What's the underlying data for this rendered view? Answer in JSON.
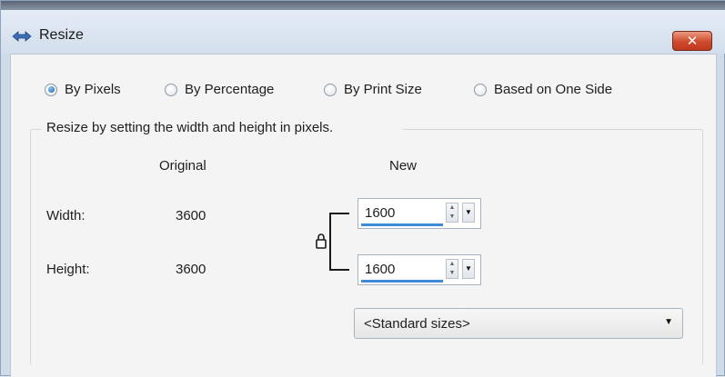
{
  "window": {
    "title": "Resize",
    "close_icon": "close-icon",
    "app_icon": "app-icon",
    "close_color": "#c9452a"
  },
  "mode_radios": [
    {
      "label": "By Pixels",
      "selected": true
    },
    {
      "label": "By Percentage",
      "selected": false
    },
    {
      "label": "By Print Size",
      "selected": false
    },
    {
      "label": "Based on One Side",
      "selected": false
    }
  ],
  "description": "Resize by setting the width and height in pixels.",
  "columns": {
    "original": "Original",
    "new": "New"
  },
  "rows": [
    {
      "label": "Width:",
      "original": "3600",
      "new": "1600"
    },
    {
      "label": "Height:",
      "original": "3600",
      "new": "1600"
    }
  ],
  "aspect_lock_icon": "lock-icon",
  "standard_sizes": {
    "selected": "<Standard sizes>"
  },
  "accent_color": "#3c8ad8"
}
